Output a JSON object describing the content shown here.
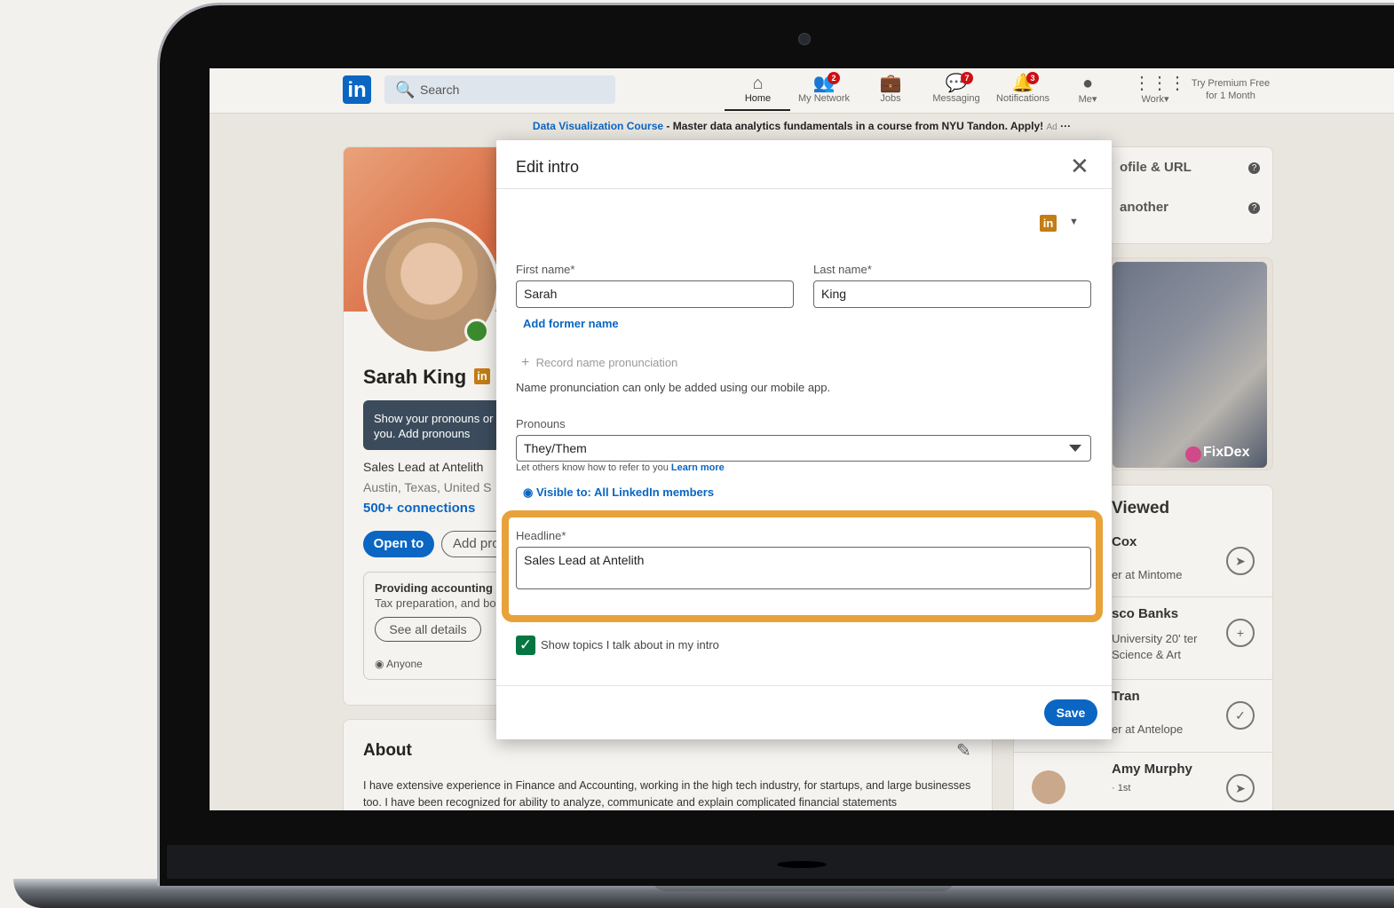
{
  "nav": {
    "search_placeholder": "Search",
    "items": [
      {
        "label": "Home",
        "badge": ""
      },
      {
        "label": "My Network",
        "badge": "2"
      },
      {
        "label": "Jobs",
        "badge": ""
      },
      {
        "label": "Messaging",
        "badge": "7"
      },
      {
        "label": "Notifications",
        "badge": "3"
      },
      {
        "label": "Me",
        "badge": ""
      },
      {
        "label": "Work",
        "badge": ""
      }
    ],
    "premium": "Try Premium Free for 1 Month"
  },
  "ad": {
    "link": "Data Visualization Course",
    "text": " - Master data analytics fundamentals in a course from NYU Tandon. Apply!",
    "tag": "Ad"
  },
  "profile": {
    "name": "Sarah King",
    "tip": "Show your pronouns or you. Add pronouns",
    "headline": "Sales Lead at Antelith",
    "location": "Austin, Texas, United S",
    "connections": "500+ connections",
    "open_to": "Open to",
    "add_profile": "Add pro",
    "services_title": "Providing accounting",
    "services_sub": "Tax preparation, and bo",
    "see_all": "See all details",
    "visibility": "Anyone"
  },
  "about": {
    "title": "About",
    "text": "I have extensive experience in Finance and Accounting, working in the high tech industry, for startups, and large businesses too. I have been recognized for ability to analyze, communicate and explain complicated financial statements"
  },
  "sidebar": {
    "row1": "ofile & URL",
    "row2": "another",
    "ad_brand": "FixDex",
    "viewed_title": "Viewed",
    "people": [
      {
        "name": "Cox",
        "desc": "er at Mintome",
        "action": "➤"
      },
      {
        "name": "sco Banks",
        "desc": "University 20' ter Science & Art",
        "action": "+"
      },
      {
        "name": "Tran",
        "desc": "er at Antelope",
        "action": "✓"
      },
      {
        "name": "Amy Murphy",
        "desc": "· 1st",
        "action": "➤"
      }
    ]
  },
  "modal": {
    "title": "Edit intro",
    "first_name_label": "First name*",
    "first_name": "Sarah",
    "last_name_label": "Last name*",
    "last_name": "King",
    "add_former": "Add former name",
    "record": "Record name pronunciation",
    "pron_note": "Name pronunciation can only be added using our mobile app.",
    "pronouns_label": "Pronouns",
    "pronouns_value": "They/Them",
    "pronoun_hint": "Let others know how to refer to you",
    "learn_more": "Learn more",
    "visible": "Visible to: All LinkedIn members",
    "headline_label": "Headline*",
    "headline_value": "Sales Lead at Antelith",
    "show_topics": "Show topics I talk about in my intro",
    "save": "Save"
  },
  "colors": {
    "accent": "#0a66c2",
    "highlight": "#e8a23a",
    "check": "#057642"
  }
}
